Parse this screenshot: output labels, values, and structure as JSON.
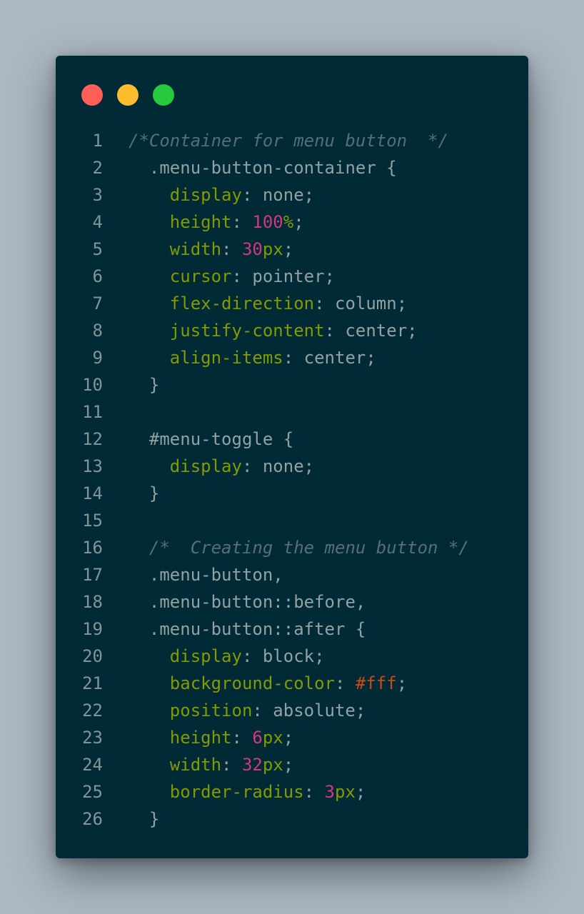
{
  "window": {
    "controls": [
      {
        "name": "close",
        "color": "#ff5f56"
      },
      {
        "name": "minimize",
        "color": "#ffbd2e"
      },
      {
        "name": "maximize",
        "color": "#27c93f"
      }
    ]
  },
  "theme": {
    "background": "#002b36",
    "plain": "#93a1a1",
    "property": "#859900",
    "number": "#d33682",
    "hex": "#cb4b16",
    "comment": "#586e75",
    "line_number": "#839496"
  },
  "code": {
    "language": "css",
    "lines": [
      {
        "n": "1",
        "indent": "",
        "tokens": [
          {
            "t": "comment",
            "v": "/*Container for menu button  */"
          }
        ]
      },
      {
        "n": "2",
        "indent": "  ",
        "tokens": [
          {
            "t": "plain",
            "v": ".menu-button-container {"
          }
        ]
      },
      {
        "n": "3",
        "indent": "    ",
        "tokens": [
          {
            "t": "prop",
            "v": "display"
          },
          {
            "t": "plain",
            "v": ": none;"
          }
        ]
      },
      {
        "n": "4",
        "indent": "    ",
        "tokens": [
          {
            "t": "prop",
            "v": "height"
          },
          {
            "t": "plain",
            "v": ": "
          },
          {
            "t": "num",
            "v": "100"
          },
          {
            "t": "prop",
            "v": "%"
          },
          {
            "t": "plain",
            "v": ";"
          }
        ]
      },
      {
        "n": "5",
        "indent": "    ",
        "tokens": [
          {
            "t": "prop",
            "v": "width"
          },
          {
            "t": "plain",
            "v": ": "
          },
          {
            "t": "num",
            "v": "30"
          },
          {
            "t": "prop",
            "v": "px"
          },
          {
            "t": "plain",
            "v": ";"
          }
        ]
      },
      {
        "n": "6",
        "indent": "    ",
        "tokens": [
          {
            "t": "prop",
            "v": "cursor"
          },
          {
            "t": "plain",
            "v": ": pointer;"
          }
        ]
      },
      {
        "n": "7",
        "indent": "    ",
        "tokens": [
          {
            "t": "prop",
            "v": "flex-direction"
          },
          {
            "t": "plain",
            "v": ": column;"
          }
        ]
      },
      {
        "n": "8",
        "indent": "    ",
        "tokens": [
          {
            "t": "prop",
            "v": "justify-content"
          },
          {
            "t": "plain",
            "v": ": center;"
          }
        ]
      },
      {
        "n": "9",
        "indent": "    ",
        "tokens": [
          {
            "t": "prop",
            "v": "align-items"
          },
          {
            "t": "plain",
            "v": ": center;"
          }
        ]
      },
      {
        "n": "10",
        "indent": "  ",
        "tokens": [
          {
            "t": "plain",
            "v": "}"
          }
        ]
      },
      {
        "n": "11",
        "indent": "",
        "tokens": []
      },
      {
        "n": "12",
        "indent": "  ",
        "tokens": [
          {
            "t": "plain",
            "v": "#menu-toggle {"
          }
        ]
      },
      {
        "n": "13",
        "indent": "    ",
        "tokens": [
          {
            "t": "prop",
            "v": "display"
          },
          {
            "t": "plain",
            "v": ": none;"
          }
        ]
      },
      {
        "n": "14",
        "indent": "  ",
        "tokens": [
          {
            "t": "plain",
            "v": "}"
          }
        ]
      },
      {
        "n": "15",
        "indent": "",
        "tokens": []
      },
      {
        "n": "16",
        "indent": "  ",
        "tokens": [
          {
            "t": "comment",
            "v": "/*  Creating the menu button */"
          }
        ]
      },
      {
        "n": "17",
        "indent": "  ",
        "tokens": [
          {
            "t": "plain",
            "v": ".menu-button,"
          }
        ]
      },
      {
        "n": "18",
        "indent": "  ",
        "tokens": [
          {
            "t": "plain",
            "v": ".menu-button::before,"
          }
        ]
      },
      {
        "n": "19",
        "indent": "  ",
        "tokens": [
          {
            "t": "plain",
            "v": ".menu-button::after {"
          }
        ]
      },
      {
        "n": "20",
        "indent": "    ",
        "tokens": [
          {
            "t": "prop",
            "v": "display"
          },
          {
            "t": "plain",
            "v": ": block;"
          }
        ]
      },
      {
        "n": "21",
        "indent": "    ",
        "tokens": [
          {
            "t": "prop",
            "v": "background-color"
          },
          {
            "t": "plain",
            "v": ": "
          },
          {
            "t": "hex",
            "v": "#fff"
          },
          {
            "t": "plain",
            "v": ";"
          }
        ]
      },
      {
        "n": "22",
        "indent": "    ",
        "tokens": [
          {
            "t": "prop",
            "v": "position"
          },
          {
            "t": "plain",
            "v": ": absolute;"
          }
        ]
      },
      {
        "n": "23",
        "indent": "    ",
        "tokens": [
          {
            "t": "prop",
            "v": "height"
          },
          {
            "t": "plain",
            "v": ": "
          },
          {
            "t": "num",
            "v": "6"
          },
          {
            "t": "prop",
            "v": "px"
          },
          {
            "t": "plain",
            "v": ";"
          }
        ]
      },
      {
        "n": "24",
        "indent": "    ",
        "tokens": [
          {
            "t": "prop",
            "v": "width"
          },
          {
            "t": "plain",
            "v": ": "
          },
          {
            "t": "num",
            "v": "32"
          },
          {
            "t": "prop",
            "v": "px"
          },
          {
            "t": "plain",
            "v": ";"
          }
        ]
      },
      {
        "n": "25",
        "indent": "    ",
        "tokens": [
          {
            "t": "prop",
            "v": "border-radius"
          },
          {
            "t": "plain",
            "v": ": "
          },
          {
            "t": "num",
            "v": "3"
          },
          {
            "t": "prop",
            "v": "px"
          },
          {
            "t": "plain",
            "v": ";"
          }
        ]
      },
      {
        "n": "26",
        "indent": "  ",
        "tokens": [
          {
            "t": "plain",
            "v": "}"
          }
        ]
      }
    ]
  }
}
